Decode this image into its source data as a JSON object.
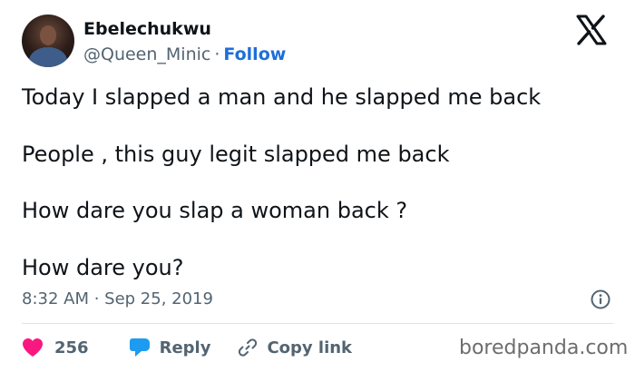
{
  "tweet": {
    "author_name": "Ebelechukwu",
    "handle": "@Queen_Minic",
    "separator": "·",
    "follow_label": "Follow",
    "lines": [
      "Today I slapped a man and he slapped me back",
      "People , this guy legit slapped me back",
      "How dare you slap a woman back ?",
      "How dare you?"
    ],
    "timestamp": "8:32 AM · Sep 25, 2019"
  },
  "actions": {
    "like_count": "256",
    "reply_label": "Reply",
    "copy_link_label": "Copy link"
  },
  "watermark": "boredpanda.com",
  "colors": {
    "follow_blue": "#1d6fd8",
    "heart_pink": "#f91880",
    "reply_blue": "#1d9bf0",
    "muted_gray": "#536471"
  },
  "icons": [
    "x-logo-icon",
    "info-icon",
    "heart-icon",
    "reply-bubble-icon",
    "link-icon"
  ]
}
